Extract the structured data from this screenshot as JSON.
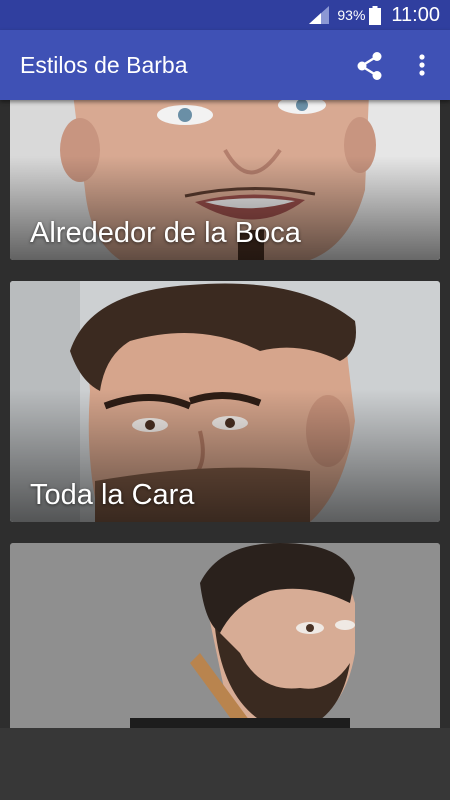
{
  "status_bar": {
    "battery_percent": "93%",
    "time": "11:00",
    "icons": [
      "signal-icon",
      "battery-icon"
    ]
  },
  "app_bar": {
    "title": "Estilos de Barba",
    "actions": [
      "share-icon",
      "more-vert-icon"
    ]
  },
  "colors": {
    "primary": "#3f51b5",
    "primary_dark": "#303f9f",
    "background": "#2e2e2e"
  },
  "cards": [
    {
      "label": "Alrededor de la Boca"
    },
    {
      "label": "Toda la Cara"
    },
    {
      "label": ""
    }
  ]
}
